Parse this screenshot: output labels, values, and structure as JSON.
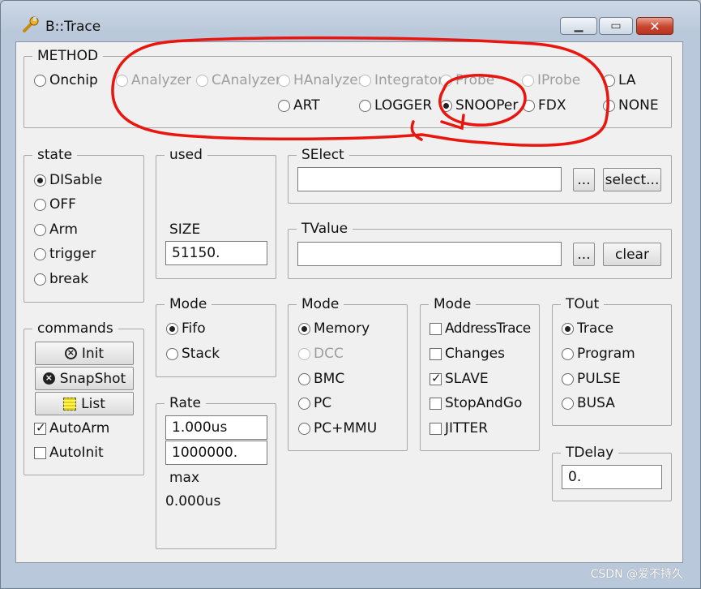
{
  "window": {
    "title": "B::Trace"
  },
  "method": {
    "label": "METHOD",
    "row1": [
      {
        "label": "Onchip",
        "selected": false,
        "disabled": false
      },
      {
        "label": "Analyzer",
        "selected": false,
        "disabled": true
      },
      {
        "label": "CAnalyzer",
        "selected": false,
        "disabled": true
      },
      {
        "label": "HAnalyzer",
        "selected": false,
        "disabled": true
      },
      {
        "label": "Integrator",
        "selected": false,
        "disabled": true
      },
      {
        "label": "Probe",
        "selected": false,
        "disabled": true
      },
      {
        "label": "IProbe",
        "selected": false,
        "disabled": true
      },
      {
        "label": "LA",
        "selected": false,
        "disabled": false
      }
    ],
    "row2": [
      {
        "label": "ART",
        "selected": false,
        "disabled": false
      },
      {
        "label": "LOGGER",
        "selected": false,
        "disabled": false
      },
      {
        "label": "SNOOPer",
        "selected": true,
        "disabled": false
      },
      {
        "label": "FDX",
        "selected": false,
        "disabled": false
      },
      {
        "label": "NONE",
        "selected": false,
        "disabled": false
      }
    ]
  },
  "state": {
    "label": "state",
    "options": [
      {
        "label": "DISable",
        "selected": true
      },
      {
        "label": "OFF",
        "selected": false
      },
      {
        "label": "Arm",
        "selected": false
      },
      {
        "label": "trigger",
        "selected": false
      },
      {
        "label": "break",
        "selected": false
      }
    ]
  },
  "used": {
    "label": "used",
    "size_label": "SIZE",
    "size_value": "51150."
  },
  "select": {
    "label": "SElect",
    "value": "",
    "browse_label": "...",
    "select_label": "select..."
  },
  "tvalue": {
    "label": "TValue",
    "value": "",
    "browse_label": "...",
    "clear_label": "clear"
  },
  "commands": {
    "label": "commands",
    "init_label": "Init",
    "snapshot_label": "SnapShot",
    "list_label": "List",
    "autoarm": {
      "label": "AutoArm",
      "checked": true
    },
    "autoinit": {
      "label": "AutoInit",
      "checked": false
    }
  },
  "mode1": {
    "label": "Mode",
    "options": [
      {
        "label": "Fifo",
        "selected": true
      },
      {
        "label": "Stack",
        "selected": false
      }
    ]
  },
  "mode2": {
    "label": "Mode",
    "options": [
      {
        "label": "Memory",
        "selected": true,
        "disabled": false
      },
      {
        "label": "DCC",
        "selected": false,
        "disabled": true
      },
      {
        "label": "BMC",
        "selected": false,
        "disabled": false
      },
      {
        "label": "PC",
        "selected": false,
        "disabled": false
      },
      {
        "label": "PC+MMU",
        "selected": false,
        "disabled": false
      }
    ]
  },
  "mode3": {
    "label": "Mode",
    "options": [
      {
        "label": "AddressTrace",
        "checked": false
      },
      {
        "label": "Changes",
        "checked": false
      },
      {
        "label": "SLAVE",
        "checked": true
      },
      {
        "label": "StopAndGo",
        "checked": false
      },
      {
        "label": "JITTER",
        "checked": false
      }
    ]
  },
  "tout": {
    "label": "TOut",
    "options": [
      {
        "label": "Trace",
        "selected": true
      },
      {
        "label": "Program",
        "selected": false
      },
      {
        "label": "PULSE",
        "selected": false
      },
      {
        "label": "BUSA",
        "selected": false
      }
    ]
  },
  "rate": {
    "label": "Rate",
    "value1": "1.000us",
    "value2": "1000000.",
    "max_label": "max",
    "max_value": "0.000us"
  },
  "tdelay": {
    "label": "TDelay",
    "value": "0."
  },
  "annotation": {
    "color": "#e8160f"
  },
  "watermark": "CSDN @爱不持久"
}
